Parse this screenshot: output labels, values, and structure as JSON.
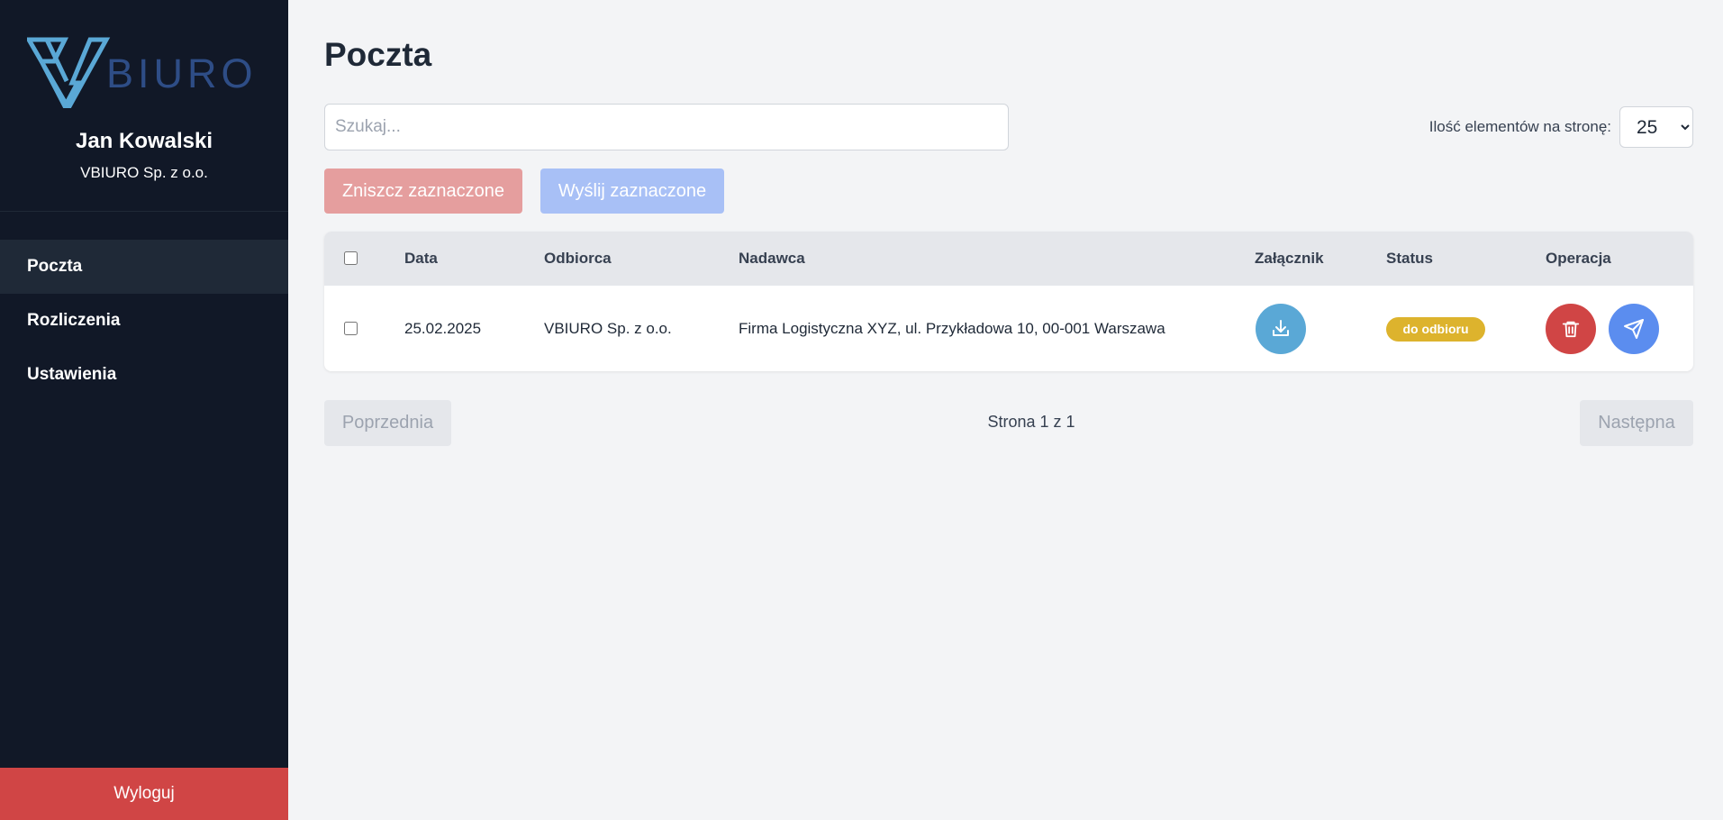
{
  "brand": {
    "logo_text": "BIURO",
    "accent": "#5aa8d6"
  },
  "user": {
    "name": "Jan Kowalski",
    "company": "VBIURO Sp. z o.o."
  },
  "nav": {
    "items": [
      {
        "label": "Poczta",
        "active": true
      },
      {
        "label": "Rozliczenia",
        "active": false
      },
      {
        "label": "Ustawienia",
        "active": false
      }
    ]
  },
  "logout_label": "Wyloguj",
  "page": {
    "title": "Poczta"
  },
  "search": {
    "placeholder": "Szukaj...",
    "value": ""
  },
  "per_page": {
    "label": "Ilość elementów na stronę:",
    "value": "25"
  },
  "actions": {
    "destroy_label": "Zniszcz zaznaczone",
    "send_label": "Wyślij zaznaczone"
  },
  "table": {
    "columns": [
      "Data",
      "Odbiorca",
      "Nadawca",
      "Załącznik",
      "Status",
      "Operacja"
    ],
    "rows": [
      {
        "date": "25.02.2025",
        "recipient": "VBIURO Sp. z o.o.",
        "sender": "Firma Logistyczna XYZ, ul. Przykładowa 10, 00-001 Warszawa",
        "attachment_icon": "download-icon",
        "status": "do odbioru",
        "operations": [
          "trash-icon",
          "send-icon"
        ]
      }
    ]
  },
  "pagination": {
    "prev_label": "Poprzednia",
    "page_text": "Strona 1 z 1",
    "next_label": "Następna"
  },
  "colors": {
    "sidebar": "#111827",
    "danger": "#d04545",
    "primary": "#5b8def",
    "info": "#5aa8d6",
    "warning": "#ddb32d"
  }
}
